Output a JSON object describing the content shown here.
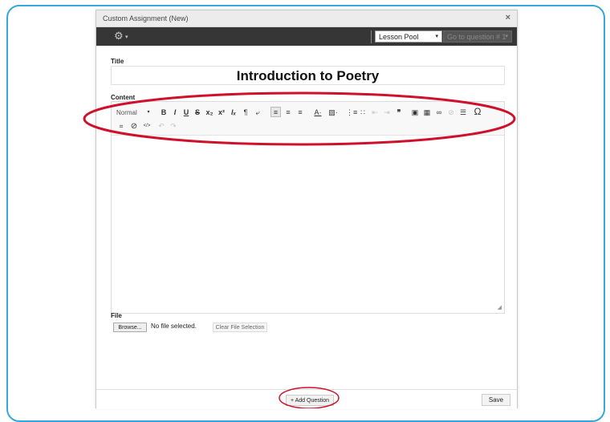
{
  "colors": {
    "frame_border": "#35a8d8",
    "dark_bar": "#363636",
    "annotation_red": "#d0102a"
  },
  "dialog": {
    "title": "Custom Assignment (New)",
    "close_glyph": "×"
  },
  "top_bar": {
    "gear_glyph": "⚙",
    "caret_glyph": "▾",
    "pool_select": "Lesson Pool",
    "goto_select": "Go to question # 1"
  },
  "form": {
    "title_label": "Title",
    "title_value": "Introduction to Poetry",
    "content_label": "Content",
    "file_label": "File",
    "browse_label": "Browse...",
    "no_file_text": "No file selected.",
    "clear_file_label": "Clear File Selection"
  },
  "editor": {
    "format_select": "Normal",
    "row1": [
      "B",
      "I",
      "U",
      "S",
      "x₂",
      "x²",
      "Iₓ",
      "¶",
      "⤶",
      "≡",
      "≡",
      "≡",
      "A·",
      "▨·",
      "⋮≡",
      "∷",
      "⇤",
      "⇥",
      "❞",
      "▣",
      "▦",
      "∞",
      "⊘",
      "☰",
      "Ω"
    ],
    "row2": [
      "⌗",
      "⊘",
      "</>",
      "↶",
      "↷"
    ],
    "resize_glyph": "◢"
  },
  "footer": {
    "add_question_label": "+ Add Question",
    "save_label": "Save"
  }
}
